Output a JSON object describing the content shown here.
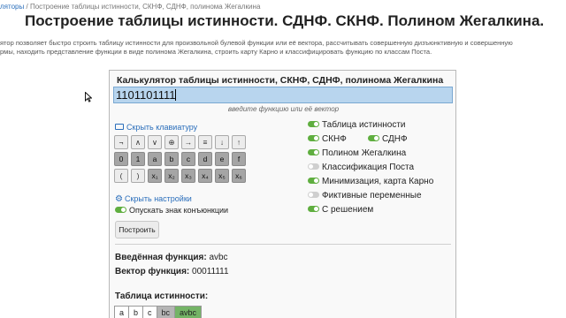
{
  "breadcrumb": {
    "link": "ляторы",
    "separator": "/",
    "current": "Построение таблицы истинности, СКНФ, СДНФ, полинома Жегалкина"
  },
  "page_title": "Построение таблицы истинности. СДНФ. СКНФ. Полином Жегалкина.",
  "description": {
    "line1": "ятор позволяет быстро строить таблицу истинности для произвольной булевой функции или её вектора, рассчитывать совершенную дизъюнктивную и совершенную",
    "line2": "рмы, находить представление функции в виде полинома Жегалкина, строить карту Карно и классифицировать функцию по классам Поста."
  },
  "calculator": {
    "title": "Калькулятор таблицы истинности, СКНФ, СДНФ, полинома Жегалкина",
    "input_value": "1101101111",
    "input_hint": "введите функцию или её вектор",
    "keyboard_toggle": "Скрыть клавиатуру",
    "keyboard": {
      "row1": [
        "¬",
        "∧",
        "∨",
        "⊕",
        "→",
        "≡",
        "↓",
        "↑"
      ],
      "row2": [
        "0",
        "1",
        "a",
        "b",
        "c",
        "d",
        "e",
        "f"
      ],
      "row3": [
        "(",
        ")",
        "x₁",
        "x₂",
        "x₃",
        "x₄",
        "x₅",
        "x₆"
      ]
    },
    "settings_toggle": "Скрыть настройки",
    "conjunction_label": "Опускать знак конъюнкции",
    "build_button": "Построить",
    "options": {
      "truth_table": "Таблица истинности",
      "sknf": "СКНФ",
      "sdnf": "СДНФ",
      "zhegalkin": "Полином Жегалкина",
      "post": "Классификация Поста",
      "karnaugh": "Минимизация, карта Карно",
      "dummy_vars": "Фиктивные переменные",
      "with_solution": "С решением"
    },
    "result": {
      "function_label": "Введённая функция:",
      "function_value": "avbc",
      "vector_label": "Вектор функция:",
      "vector_value": "00011111",
      "truth_table_label": "Таблица истинности:",
      "headers": [
        "a",
        "b",
        "c",
        "bc",
        "avbc"
      ]
    }
  },
  "colors": {
    "accent": "#5fae3f",
    "input_highlight": "#b8d5ee",
    "link": "#2a6ebb"
  }
}
